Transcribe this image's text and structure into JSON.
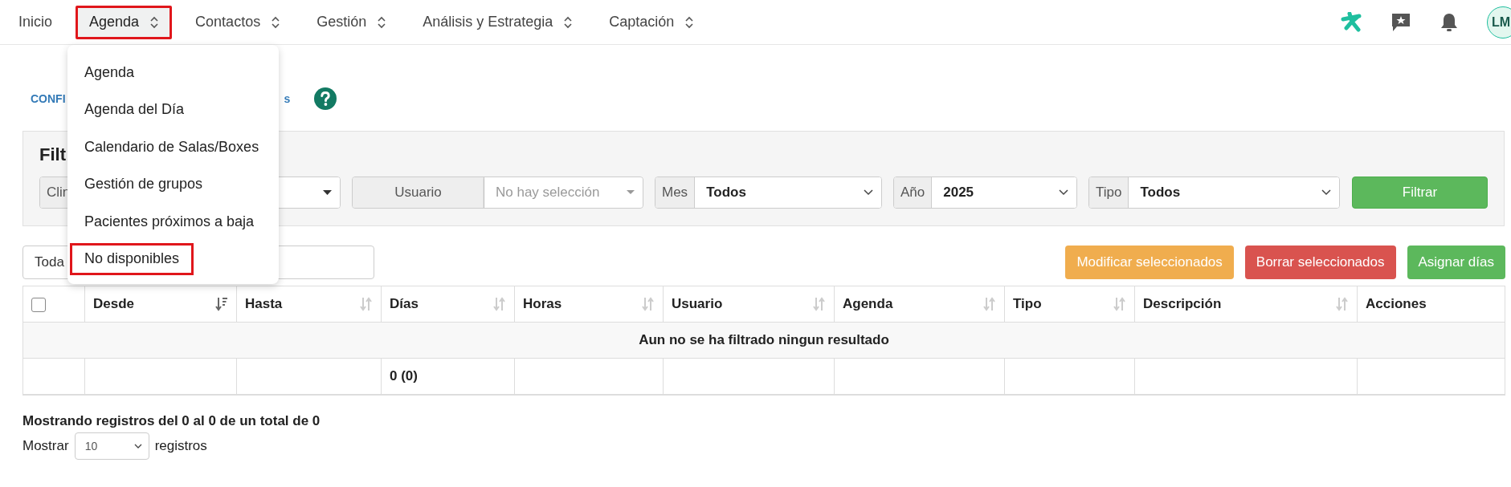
{
  "nav": {
    "items": [
      {
        "label": "Inicio",
        "selected": false,
        "has_menu": false,
        "highlighted": false
      },
      {
        "label": "Agenda",
        "selected": true,
        "has_menu": true,
        "highlighted": true
      },
      {
        "label": "Contactos",
        "selected": false,
        "has_menu": true,
        "highlighted": false
      },
      {
        "label": "Gestión",
        "selected": false,
        "has_menu": true,
        "highlighted": false
      },
      {
        "label": "Análisis y Estrategia",
        "selected": false,
        "has_menu": true,
        "highlighted": false
      },
      {
        "label": "Captación",
        "selected": false,
        "has_menu": true,
        "highlighted": false
      }
    ],
    "avatar": "LM"
  },
  "menu": {
    "items": [
      {
        "label": "Agenda",
        "highlighted": false
      },
      {
        "label": "Agenda del Día",
        "highlighted": false
      },
      {
        "label": "Calendario de Salas/Boxes",
        "highlighted": false
      },
      {
        "label": "Gestión de grupos",
        "highlighted": false
      },
      {
        "label": "Pacientes próximos a baja",
        "highlighted": false
      },
      {
        "label": "No disponibles",
        "highlighted": true
      }
    ]
  },
  "links": {
    "left": "CONFI",
    "right": "s"
  },
  "filters": {
    "title": "Filt",
    "groups": [
      {
        "kind": "hidden-select",
        "label": "Clin"
      },
      {
        "kind": "picker",
        "label": "Usuario",
        "placeholder": "No hay selección"
      },
      {
        "kind": "select",
        "label": "Mes",
        "value": "Todos"
      },
      {
        "kind": "select",
        "label": "Año",
        "value": "2025"
      },
      {
        "kind": "select",
        "label": "Tipo",
        "value": "Todos"
      }
    ],
    "button": "Filtrar"
  },
  "scope_field": {
    "value": "Toda"
  },
  "actions": [
    {
      "label": "Modificar seleccionados",
      "color": "#f0ad4e"
    },
    {
      "label": "Borrar seleccionados",
      "color": "#d9534f"
    },
    {
      "label": "Asignar días",
      "color": "#5cb85c"
    }
  ],
  "table": {
    "select_all_checked": false,
    "columns": [
      {
        "label": "Desde",
        "sortable": true,
        "sorted": true
      },
      {
        "label": "Hasta",
        "sortable": true,
        "sorted": false
      },
      {
        "label": "Días",
        "sortable": true,
        "sorted": false
      },
      {
        "label": "Horas",
        "sortable": true,
        "sorted": false
      },
      {
        "label": "Usuario",
        "sortable": true,
        "sorted": false
      },
      {
        "label": "Agenda",
        "sortable": true,
        "sorted": false
      },
      {
        "label": "Tipo",
        "sortable": true,
        "sorted": false
      },
      {
        "label": "Descripción",
        "sortable": true,
        "sorted": false
      },
      {
        "label": "Acciones",
        "sortable": false
      }
    ],
    "empty_message": "Aun no se ha filtrado ningun resultado",
    "totals_row": {
      "days_total": "0 (0)"
    }
  },
  "info": "Mostrando registros del 0 al 0 de un total de 0",
  "page_length": {
    "before": "Mostrar",
    "value": "10",
    "after": "registros"
  }
}
